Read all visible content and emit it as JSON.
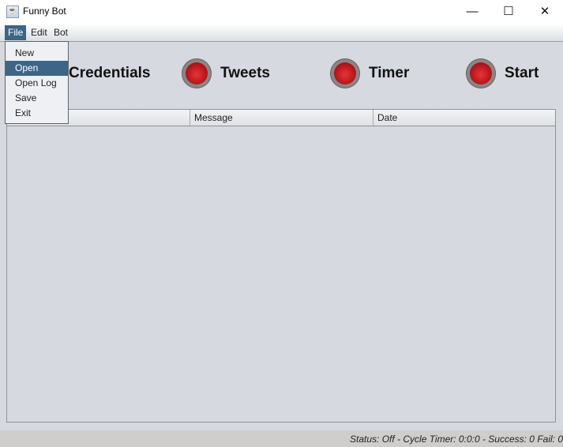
{
  "window": {
    "title": "Funny Bot",
    "controls": {
      "minimize": "—",
      "maximize": "☐",
      "close": "✕"
    }
  },
  "menubar": {
    "menus": [
      {
        "label": "File",
        "active": true
      },
      {
        "label": "Edit",
        "active": false
      },
      {
        "label": "Bot",
        "active": false
      }
    ]
  },
  "file_menu": {
    "items": [
      {
        "label": "New"
      },
      {
        "label": "Open",
        "selected": true
      },
      {
        "label": "Open Log"
      },
      {
        "label": "Save"
      },
      {
        "label": "Exit"
      }
    ]
  },
  "indicators": [
    {
      "label": "Credentials",
      "visible_label": "redentials",
      "state": "off",
      "color": "#c41c22"
    },
    {
      "label": "Tweets",
      "state": "off",
      "color": "#c41c22"
    },
    {
      "label": "Timer",
      "state": "off",
      "color": "#c41c22"
    },
    {
      "label": "Start",
      "state": "off",
      "color": "#c41c22"
    }
  ],
  "table": {
    "columns": [
      "",
      "Message",
      "Date"
    ],
    "rows": []
  },
  "statusbar": {
    "text": "Status: Off - Cycle Timer: 0:0:0 - Success: 0 Fail: 0"
  },
  "colors": {
    "accent": "#3d6586",
    "background": "#d6d9df",
    "led_red": "#c41c22"
  }
}
